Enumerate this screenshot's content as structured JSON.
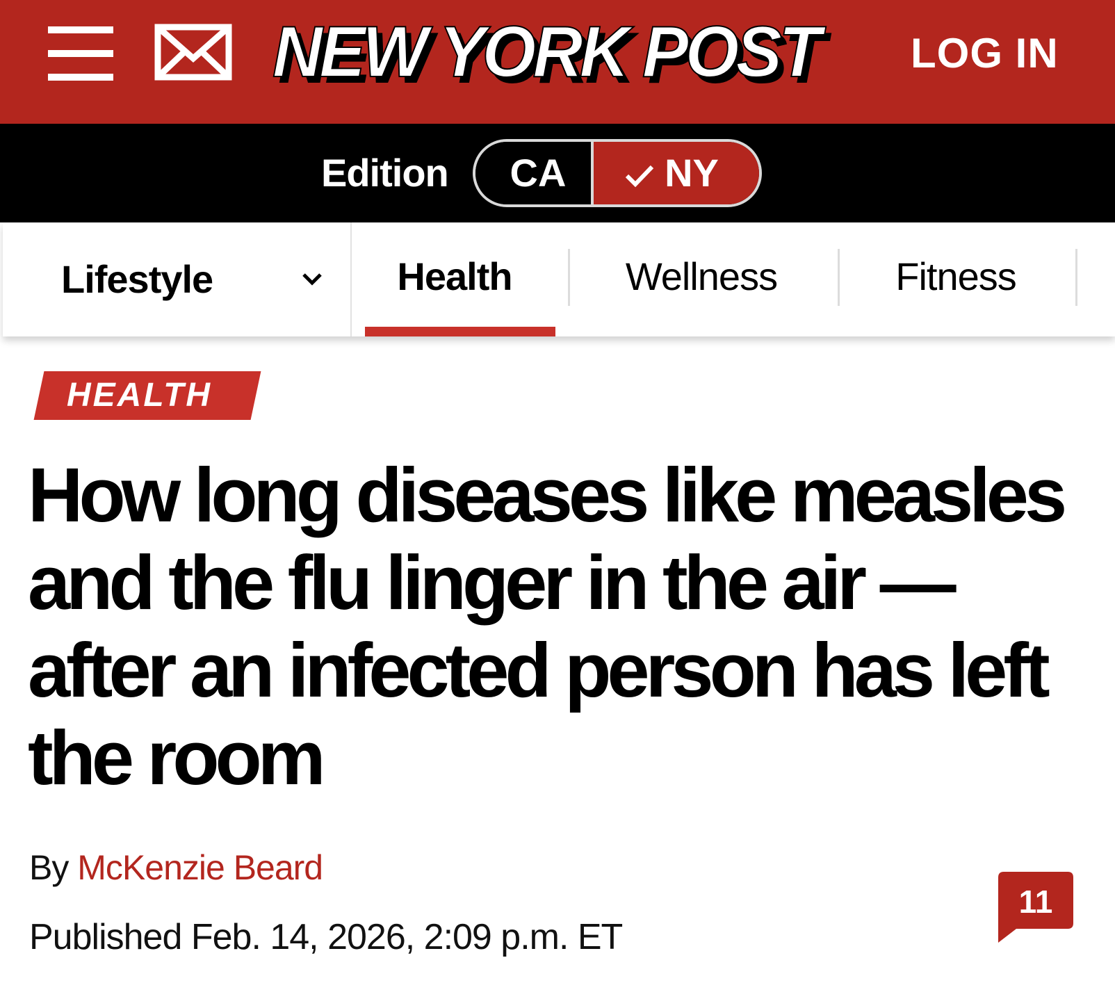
{
  "header": {
    "logo": "NEW YORK POST",
    "login_label": "LOG IN",
    "menu_icon": "hamburger-menu-icon",
    "mail_icon": "mail-icon",
    "brand_color": "#b3261e"
  },
  "edition": {
    "label": "Edition",
    "options": [
      "CA",
      "NY"
    ],
    "selected": "NY",
    "check_icon": "checkmark-icon"
  },
  "nav": {
    "section": "Lifestyle",
    "section_icon": "chevron-down-icon",
    "tabs": [
      {
        "label": "Health",
        "active": true
      },
      {
        "label": "Wellness",
        "active": false
      },
      {
        "label": "Fitness",
        "active": false
      }
    ]
  },
  "article": {
    "kicker": "HEALTH",
    "headline": "How long diseases like measles and the flu linger in the air — after an infected person has left the room",
    "byline_prefix": "By",
    "author": "McKenzie Beard",
    "published": "Published Feb. 14, 2026, 2:09 p.m. ET",
    "comment_count": "11",
    "comment_icon": "comment-bubble-icon"
  }
}
